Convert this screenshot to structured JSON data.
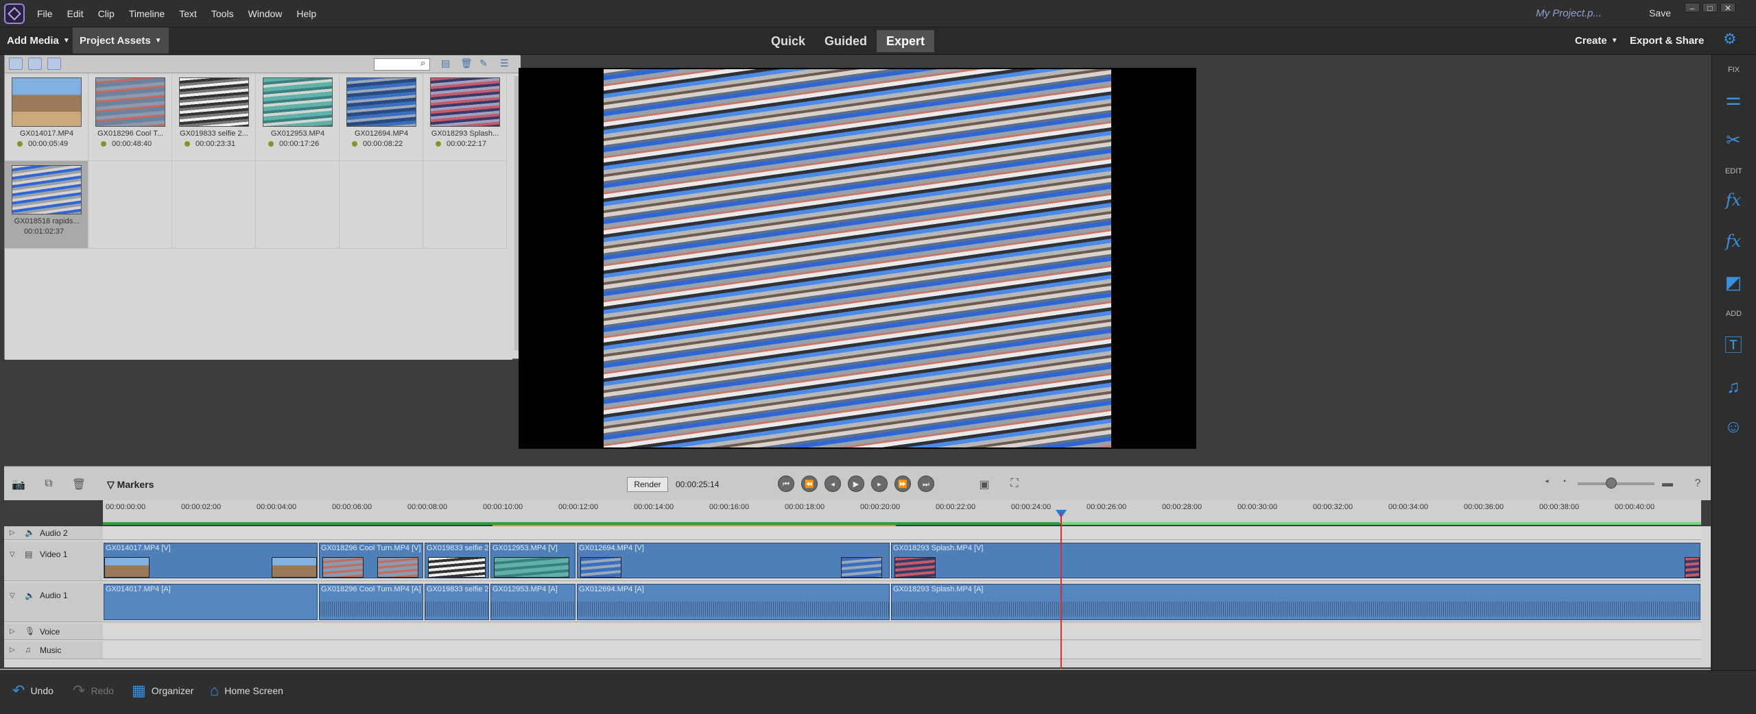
{
  "menubar": {
    "items": [
      "File",
      "Edit",
      "Clip",
      "Timeline",
      "Text",
      "Tools",
      "Window",
      "Help"
    ],
    "project_name": "My Project.p...",
    "save_label": "Save"
  },
  "modebar": {
    "add_media": "Add Media",
    "project_assets": "Project Assets",
    "modes": [
      "Quick",
      "Guided",
      "Expert"
    ],
    "active_mode": "Expert",
    "create": "Create",
    "export_share": "Export & Share"
  },
  "assets": {
    "clips": [
      {
        "name": "GX014017.MP4",
        "duration": "00:00:05:49"
      },
      {
        "name": "GX018296 Cool T...",
        "duration": "00:00:48:40"
      },
      {
        "name": "GX019833 selfie 2...",
        "duration": "00:00:23:31"
      },
      {
        "name": "GX012953.MP4",
        "duration": "00:00:17:26"
      },
      {
        "name": "GX012694.MP4",
        "duration": "00:00:08:22"
      },
      {
        "name": "GX018293 Splash...",
        "duration": "00:00:22:17"
      },
      {
        "name": "GX018518 rapids...",
        "duration": "00:01:02:37"
      }
    ]
  },
  "rightpanel": {
    "fix": "FIX",
    "edit": "EDIT",
    "add": "ADD"
  },
  "timeline": {
    "markers_label": "Markers",
    "render_label": "Render",
    "timecode": "00:00:25:14",
    "ruler": [
      "00:00:00:00",
      "00:00:02:00",
      "00:00:04:00",
      "00:00:06:00",
      "00:00:08:00",
      "00:00:10:00",
      "00:00:12:00",
      "00:00:14:00",
      "00:00:16:00",
      "00:00:18:00",
      "00:00:20:00",
      "00:00:22:00",
      "00:00:24:00",
      "00:00:26:00",
      "00:00:28:00",
      "00:00:30:00",
      "00:00:32:00",
      "00:00:34:00",
      "00:00:36:00",
      "00:00:38:00",
      "00:00:40:00"
    ],
    "tracks": {
      "audio2": "Audio 2",
      "video1": "Video 1",
      "audio1": "Audio 1",
      "voice": "Voice",
      "music": "Music"
    },
    "video_clips": [
      "GX014017.MP4 [V]",
      "GX018296 Cool Turn.MP4 [V]",
      "GX019833 selfie 2",
      "GX012953.MP4 [V]",
      "GX012694.MP4 [V]",
      "GX018293 Splash.MP4 [V]"
    ],
    "audio_clips": [
      "GX014017.MP4 [A]",
      "GX018296 Cool Turn.MP4 [A]",
      "GX019833 selfie 2",
      "GX012953.MP4 [A]",
      "GX012694.MP4 [A]",
      "GX018293 Splash.MP4 [A]"
    ]
  },
  "bottombar": {
    "undo": "Undo",
    "redo": "Redo",
    "organizer": "Organizer",
    "home": "Home Screen"
  }
}
